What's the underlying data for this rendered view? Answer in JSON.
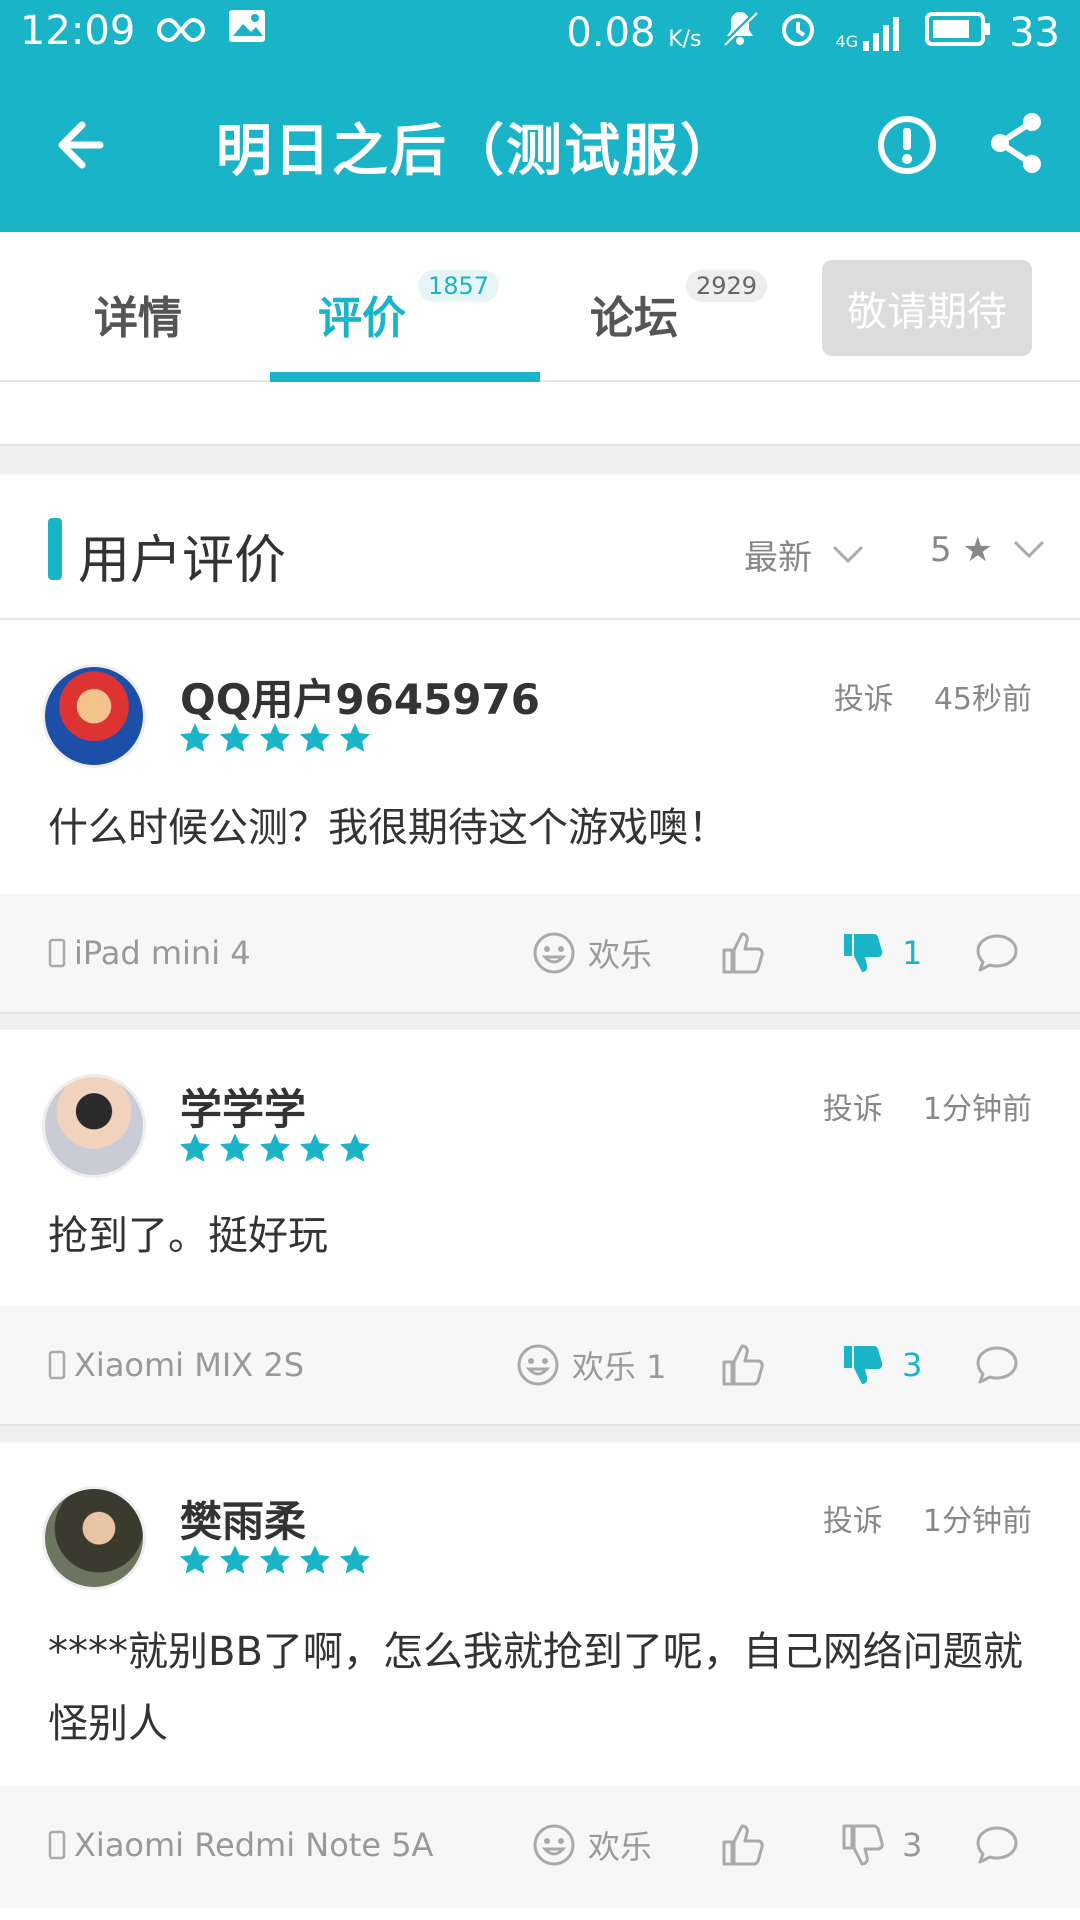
{
  "status_bar": {
    "time": "12:09",
    "speed": "0.08",
    "speed_unit": "K/s",
    "network": "4G",
    "battery": "33",
    "icons": [
      "infinity-icon",
      "gallery-icon",
      "mute-icon",
      "alarm-icon",
      "signal-icon",
      "battery-icon"
    ]
  },
  "app_bar": {
    "title": "明日之后（测试服）",
    "back_icon": "arrow-left-icon",
    "report_icon": "exclamation-circle-icon",
    "share_icon": "share-icon"
  },
  "tabs": [
    {
      "label": "详情",
      "badge": ""
    },
    {
      "label": "评价",
      "badge": "1857",
      "active": true
    },
    {
      "label": "论坛",
      "badge": "2929"
    }
  ],
  "coming_button": "敬请期待",
  "section": {
    "title": "用户评价",
    "sort_label": "最新",
    "star_filter": "5 ★"
  },
  "colors": {
    "accent": "#19b4c8",
    "star": "#19b4c8"
  },
  "reviews": [
    {
      "user": "QQ用户9645976",
      "stars": 5,
      "report": "投诉",
      "time": "45秒前",
      "content": "什么时候公测？我很期待这个游戏噢！",
      "device": "iPad mini 4",
      "fun_label": "欢乐",
      "dislike_count": "1",
      "dislike_active": true
    },
    {
      "user": "学学学",
      "stars": 5,
      "report": "投诉",
      "time": "1分钟前",
      "content": "抢到了。挺好玩",
      "device": "Xiaomi MIX 2S",
      "fun_label": "欢乐 1",
      "dislike_count": "3",
      "dislike_active": true
    },
    {
      "user": "樊雨柔",
      "stars": 5,
      "report": "投诉",
      "time": "1分钟前",
      "content": "****就别BB了啊，怎么我就抢到了呢，自己网络问题就怪别人",
      "device": "Xiaomi Redmi Note 5A",
      "fun_label": "欢乐",
      "dislike_count": "3",
      "dislike_active": false
    }
  ]
}
